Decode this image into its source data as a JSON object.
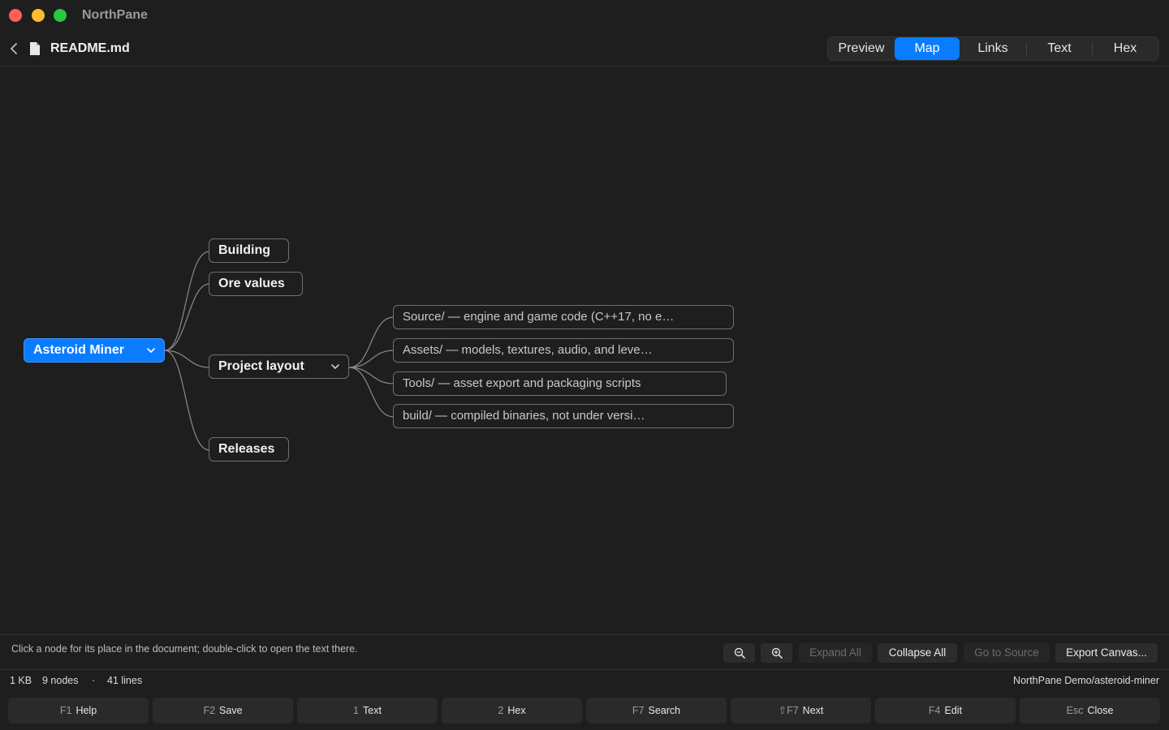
{
  "app": {
    "title": "NorthPane"
  },
  "header": {
    "file_name": "README.md"
  },
  "view_tabs": [
    {
      "label": "Preview",
      "active": false
    },
    {
      "label": "Map",
      "active": true
    },
    {
      "label": "Links",
      "active": false
    },
    {
      "label": "Text",
      "active": false
    },
    {
      "label": "Hex",
      "active": false
    }
  ],
  "map": {
    "root": {
      "label": "Asteroid Miner",
      "expanded": true
    },
    "sections": [
      {
        "label": "Building"
      },
      {
        "label": "Ore values"
      },
      {
        "label": "Project layout",
        "expanded": true
      },
      {
        "label": "Releases"
      }
    ],
    "children": [
      {
        "label": "Source/ — engine and game code (C++17, no e…"
      },
      {
        "label": "Assets/ — models, textures, audio, and leve…"
      },
      {
        "label": "Tools/ — asset export and packaging scripts"
      },
      {
        "label": "build/ — compiled binaries, not under versi…"
      }
    ]
  },
  "toolbar": {
    "hint": "Click a node for its place in the document; double-click to open the text there.",
    "zoom_out_icon": "zoom-out-icon",
    "zoom_in_icon": "zoom-in-icon",
    "expand_all": "Expand All",
    "collapse_all": "Collapse All",
    "go_to_source": "Go to Source",
    "export_canvas": "Export Canvas..."
  },
  "status": {
    "size": "1 KB",
    "nodes": "9 nodes",
    "separator": "·",
    "lines": "41 lines",
    "path": "NorthPane Demo/asteroid-miner"
  },
  "fkeys": [
    {
      "key": "F1",
      "label": "Help"
    },
    {
      "key": "F2",
      "label": "Save"
    },
    {
      "key": "1",
      "label": "Text"
    },
    {
      "key": "2",
      "label": "Hex"
    },
    {
      "key": "F7",
      "label": "Search"
    },
    {
      "key": "⇧F7",
      "label": "Next"
    },
    {
      "key": "F4",
      "label": "Edit"
    },
    {
      "key": "Esc",
      "label": "Close"
    }
  ],
  "colors": {
    "accent": "#0a7cff",
    "background": "#1e1e1e"
  }
}
